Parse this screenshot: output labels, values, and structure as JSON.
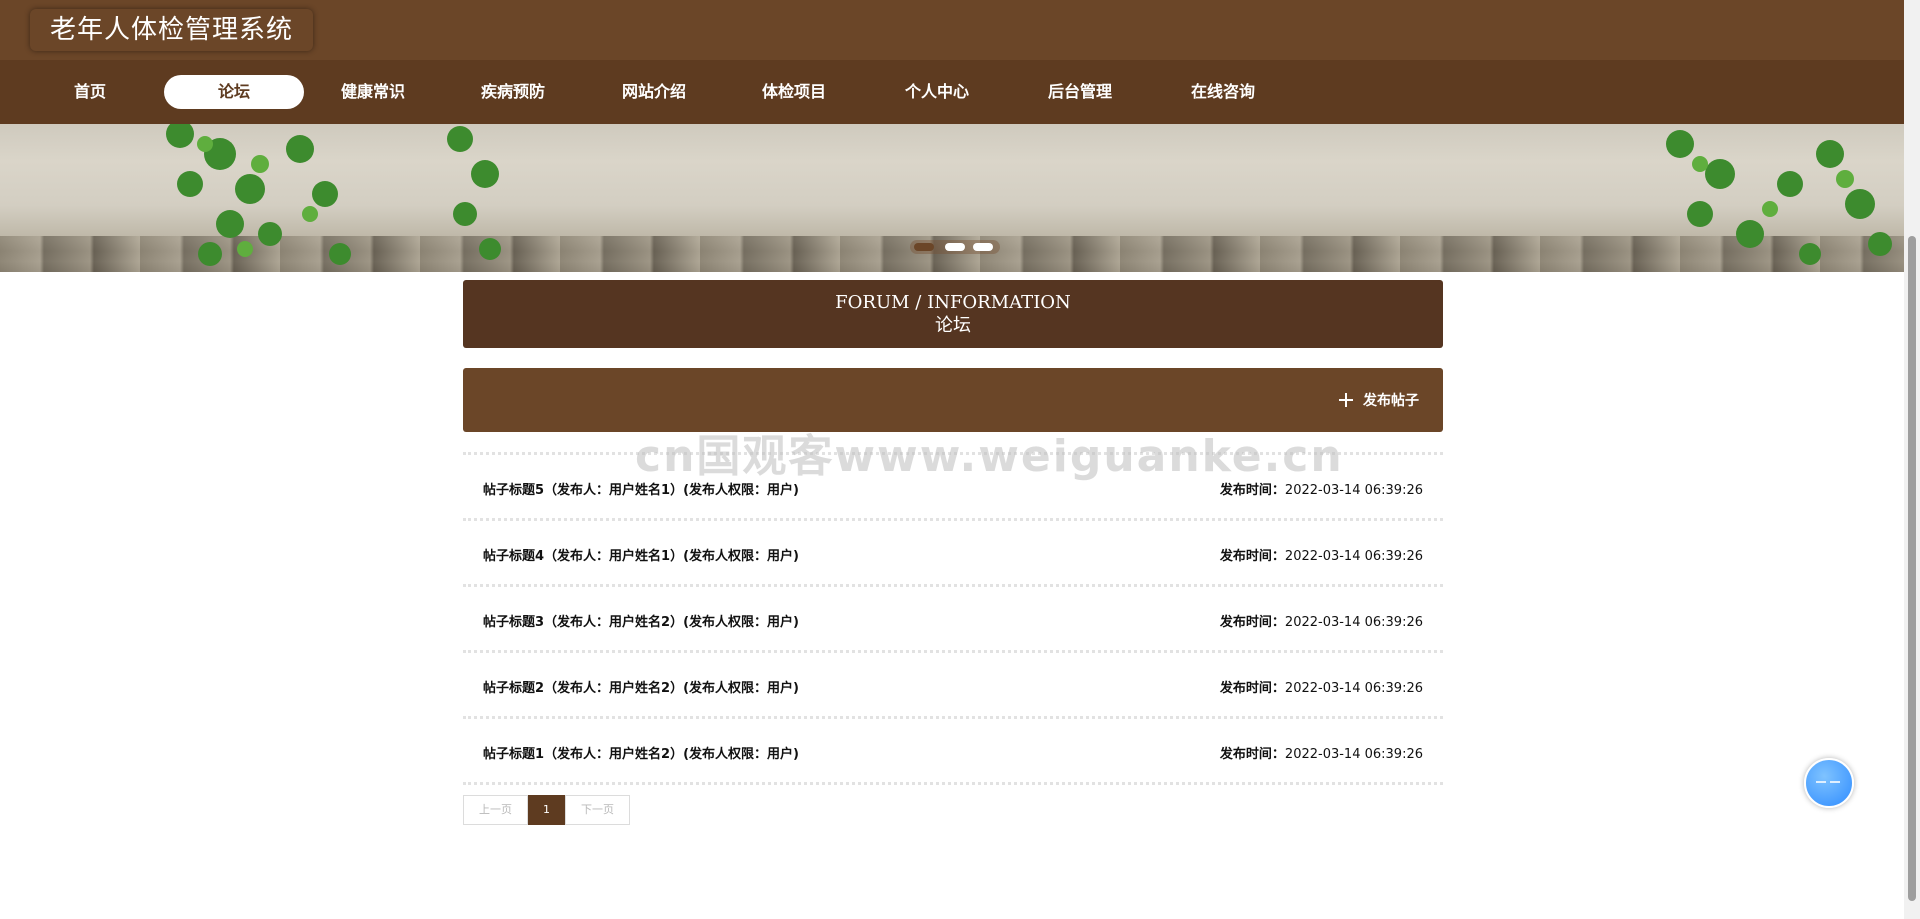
{
  "header": {
    "site_title": "老年人体检管理系统"
  },
  "nav": {
    "items": [
      {
        "label": "首页"
      },
      {
        "label": "论坛"
      },
      {
        "label": "健康常识"
      },
      {
        "label": "疾病预防"
      },
      {
        "label": "网站介绍"
      },
      {
        "label": "体检项目"
      },
      {
        "label": "个人中心"
      },
      {
        "label": "后台管理"
      },
      {
        "label": "在线咨询"
      }
    ],
    "active_index": 1
  },
  "banner": {
    "slide_count": 3,
    "active_slide": 1
  },
  "section": {
    "title_en": "FORUM / INFORMATION",
    "title_cn": "论坛"
  },
  "actions": {
    "post_label": "发布帖子"
  },
  "posts": [
    {
      "title": "帖子标题5（发布人：用户姓名1）(发布人权限：用户)",
      "time_label": "发布时间：",
      "time": "2022-03-14 06:39:26"
    },
    {
      "title": "帖子标题4（发布人：用户姓名1）(发布人权限：用户)",
      "time_label": "发布时间：",
      "time": "2022-03-14 06:39:26"
    },
    {
      "title": "帖子标题3（发布人：用户姓名2）(发布人权限：用户)",
      "time_label": "发布时间：",
      "time": "2022-03-14 06:39:26"
    },
    {
      "title": "帖子标题2（发布人：用户姓名2）(发布人权限：用户)",
      "time_label": "发布时间：",
      "time": "2022-03-14 06:39:26"
    },
    {
      "title": "帖子标题1（发布人：用户姓名2）(发布人权限：用户)",
      "time_label": "发布时间：",
      "time": "2022-03-14 06:39:26"
    }
  ],
  "pagination": {
    "prev_label": "上一页",
    "current": "1",
    "next_label": "下一页"
  },
  "watermark": {
    "text": "cn国观客www.weiguanke.cn"
  },
  "icons": {
    "post": "plus-icon",
    "float": "chat-icon"
  },
  "colors": {
    "brand": "#6b4628",
    "nav": "#5e3b20",
    "section": "#553521"
  }
}
